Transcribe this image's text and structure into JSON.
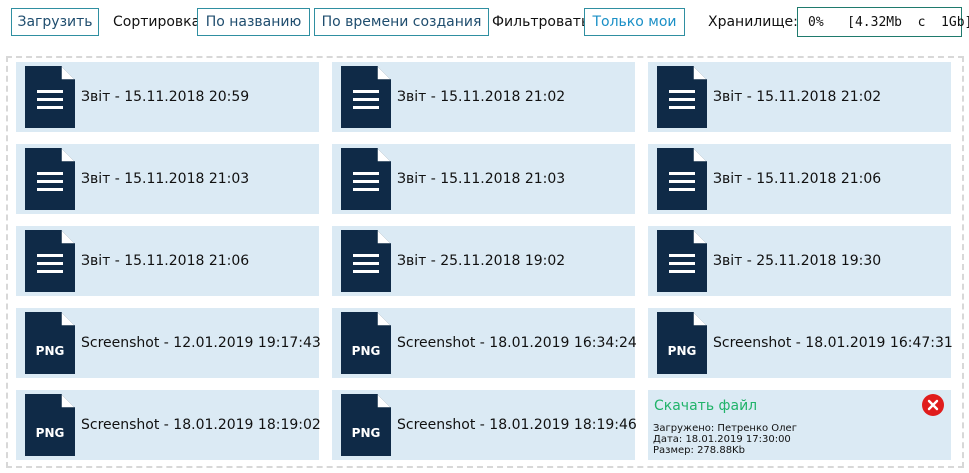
{
  "toolbar": {
    "upload_label": "Загрузить",
    "sort_label": "Сортировка:",
    "sort_by_name": "По названию",
    "sort_by_created": "По времени создания",
    "filter_label": "Фильтровать:",
    "filter_mine": "Только мои",
    "storage_label": "Хранилище:",
    "storage_value": "0%   [4.32Mb  с  1Gb]"
  },
  "files": [
    {
      "name": "Звіт - 15.11.2018 20:59",
      "icon": "document-icon"
    },
    {
      "name": "Звіт - 15.11.2018 21:02",
      "icon": "document-icon"
    },
    {
      "name": "Звіт - 15.11.2018 21:02",
      "icon": "document-icon"
    },
    {
      "name": "Звіт - 15.11.2018 21:03",
      "icon": "document-icon"
    },
    {
      "name": "Звіт - 15.11.2018 21:03",
      "icon": "document-icon"
    },
    {
      "name": "Звіт - 15.11.2018 21:06",
      "icon": "document-icon"
    },
    {
      "name": "Звіт - 15.11.2018 21:06",
      "icon": "document-icon"
    },
    {
      "name": "Звіт - 25.11.2018 19:02",
      "icon": "document-icon"
    },
    {
      "name": "Звіт - 25.11.2018 19:30",
      "icon": "document-icon"
    },
    {
      "name": "Screenshot - 12.01.2019 19:17:43",
      "icon": "png-file-icon",
      "badge": "PNG"
    },
    {
      "name": "Screenshot - 18.01.2019 16:34:24",
      "icon": "png-file-icon",
      "badge": "PNG"
    },
    {
      "name": "Screenshot - 18.01.2019 16:47:31",
      "icon": "png-file-icon",
      "badge": "PNG"
    },
    {
      "name": "Screenshot - 18.01.2019 18:19:02",
      "icon": "png-file-icon",
      "badge": "PNG"
    },
    {
      "name": "Screenshot - 18.01.2019 18:19:46",
      "icon": "png-file-icon",
      "badge": "PNG"
    }
  ],
  "selected_file": {
    "download_label": "Скачать файл",
    "uploaded_by": "Загружено: Петренко Олег",
    "date": "Дата: 18.01.2019 17:30:00",
    "size": "Размер: 278.88Kb",
    "close_icon": "close-icon"
  },
  "colors": {
    "accent": "#2f8fa1",
    "tile_bg": "#dbeaf4",
    "icon_dark": "#0f2a47",
    "download_green": "#21b36a",
    "close_red": "#e01c1c"
  }
}
